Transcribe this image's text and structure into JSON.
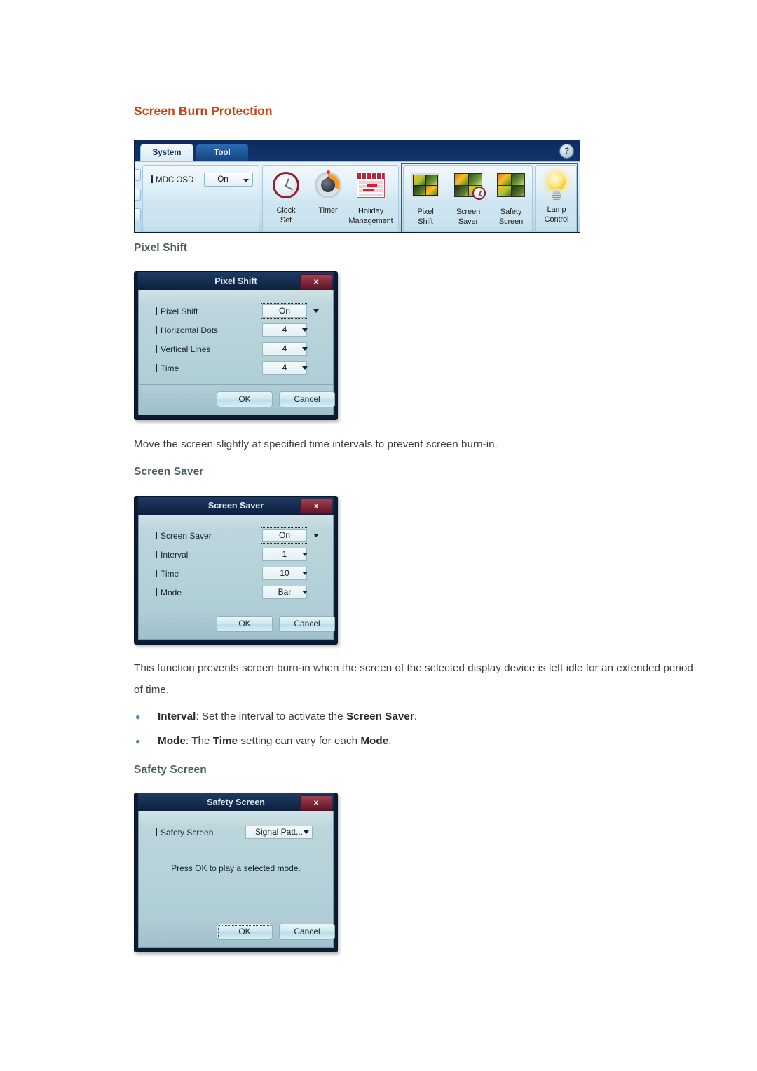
{
  "page": {
    "title": "Screen Burn Protection"
  },
  "mdc_window": {
    "tabs": [
      {
        "label": "System",
        "active": true
      },
      {
        "label": "Tool",
        "active": false
      }
    ],
    "help_icon": "?",
    "osd": {
      "label": "MDC OSD",
      "value": "On"
    },
    "toolbar_items": [
      {
        "label_line1": "Clock",
        "label_line2": "Set",
        "icon": "clock-icon"
      },
      {
        "label_line1": "Timer",
        "label_line2": "",
        "icon": "timer-icon"
      },
      {
        "label_line1": "Holiday",
        "label_line2": "Management",
        "icon": "calendar-icon"
      },
      {
        "label_line1": "Pixel",
        "label_line2": "Shift",
        "icon": "pixel-shift-icon"
      },
      {
        "label_line1": "Screen",
        "label_line2": "Saver",
        "icon": "screen-saver-icon"
      },
      {
        "label_line1": "Safety",
        "label_line2": "Screen",
        "icon": "safety-screen-icon"
      },
      {
        "label_line1": "Lamp",
        "label_line2": "Control",
        "icon": "lamp-icon"
      }
    ],
    "selection_highlight_color": "#3a46d8"
  },
  "sections": [
    {
      "heading": "Pixel Shift",
      "description": "Move the screen slightly at specified time intervals to prevent screen burn-in."
    },
    {
      "heading": "Screen Saver",
      "description": "This function prevents screen burn-in when the screen of the selected display device is left idle for an extended period of time."
    },
    {
      "heading": "Safety Screen",
      "description": ""
    }
  ],
  "pixel_shift_dialog": {
    "title": "Pixel Shift",
    "close_label": "x",
    "rows": [
      {
        "label": "Pixel Shift",
        "value": "On",
        "focused": true
      },
      {
        "label": "Horizontal Dots",
        "value": "4",
        "focused": false
      },
      {
        "label": "Vertical Lines",
        "value": "4",
        "focused": false
      },
      {
        "label": "Time",
        "value": "4",
        "focused": false
      }
    ],
    "ok_label": "OK",
    "cancel_label": "Cancel"
  },
  "screen_saver_dialog": {
    "title": "Screen Saver",
    "close_label": "x",
    "rows": [
      {
        "label": "Screen Saver",
        "value": "On",
        "focused": true
      },
      {
        "label": "Interval",
        "value": "1",
        "focused": false
      },
      {
        "label": "Time",
        "value": "10",
        "focused": false
      },
      {
        "label": "Mode",
        "value": "Bar",
        "focused": false
      }
    ],
    "ok_label": "OK",
    "cancel_label": "Cancel"
  },
  "safety_screen_dialog": {
    "title": "Safety Screen",
    "close_label": "x",
    "row": {
      "label": "Safety Screen",
      "value": "Signal Patt..."
    },
    "note": "Press OK to play a selected mode.",
    "ok_label": "OK",
    "cancel_label": "Cancel"
  },
  "screen_saver_bullets": [
    {
      "term": "Interval",
      "mid": ": Set the interval to activate the ",
      "strong": "Screen Saver",
      "tail": "."
    },
    {
      "term": "Mode",
      "mid": ": The ",
      "strong": "Time",
      "mid2": " setting can vary for each ",
      "strong2": "Mode",
      "tail": "."
    }
  ],
  "colors": {
    "heading": "#c8420d",
    "subheading": "#4e5f66",
    "bullet": "#4a7fd0"
  }
}
